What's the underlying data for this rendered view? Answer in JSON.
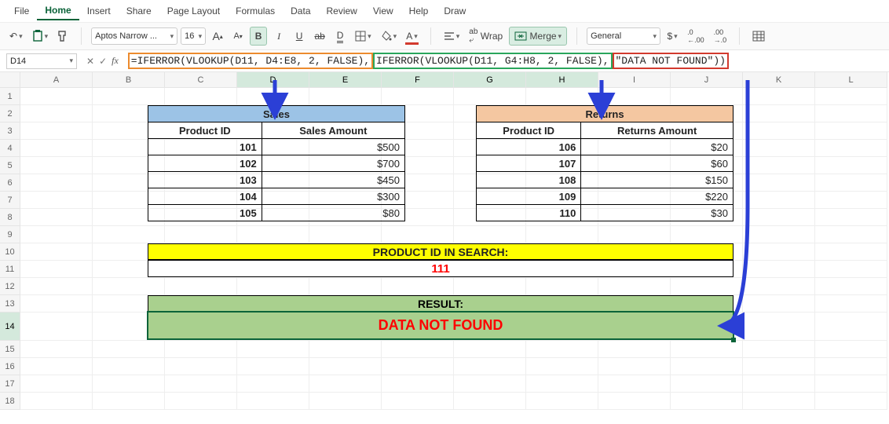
{
  "tabs": [
    "File",
    "Home",
    "Insert",
    "Share",
    "Page Layout",
    "Formulas",
    "Data",
    "Review",
    "View",
    "Help",
    "Draw"
  ],
  "active_tab_index": 1,
  "toolbar": {
    "font_name": "Aptos Narrow ...",
    "font_size": "16",
    "wrap_label": "Wrap",
    "merge_label": "Merge",
    "format_label": "General"
  },
  "name_box": "D14",
  "formula": {
    "seg1": "=IFERROR(VLOOKUP(D11, D4:E8, 2, FALSE),",
    "seg2": "IFERROR(VLOOKUP(D11, G4:H8, 2, FALSE),",
    "seg3": "\"DATA NOT FOUND\"))"
  },
  "columns": [
    "A",
    "B",
    "C",
    "D",
    "E",
    "F",
    "G",
    "H",
    "I",
    "J",
    "K",
    "L"
  ],
  "row_nums": [
    "1",
    "2",
    "3",
    "4",
    "5",
    "6",
    "7",
    "8",
    "9",
    "10",
    "11",
    "12",
    "13",
    "14",
    "15",
    "16",
    "17",
    "18"
  ],
  "sales": {
    "title": "Sales",
    "col1": "Product ID",
    "col2": "Sales Amount",
    "rows": [
      {
        "id": "101",
        "amt": "$500"
      },
      {
        "id": "102",
        "amt": "$700"
      },
      {
        "id": "103",
        "amt": "$450"
      },
      {
        "id": "104",
        "amt": "$300"
      },
      {
        "id": "105",
        "amt": "$80"
      }
    ]
  },
  "returns": {
    "title": "Returns",
    "col1": "Product ID",
    "col2": "Returns Amount",
    "rows": [
      {
        "id": "106",
        "amt": "$20"
      },
      {
        "id": "107",
        "amt": "$60"
      },
      {
        "id": "108",
        "amt": "$150"
      },
      {
        "id": "109",
        "amt": "$220"
      },
      {
        "id": "110",
        "amt": "$30"
      }
    ]
  },
  "search_label": "PRODUCT ID IN SEARCH:",
  "search_value": "111",
  "result_label": "RESULT:",
  "result_value": "DATA NOT FOUND"
}
